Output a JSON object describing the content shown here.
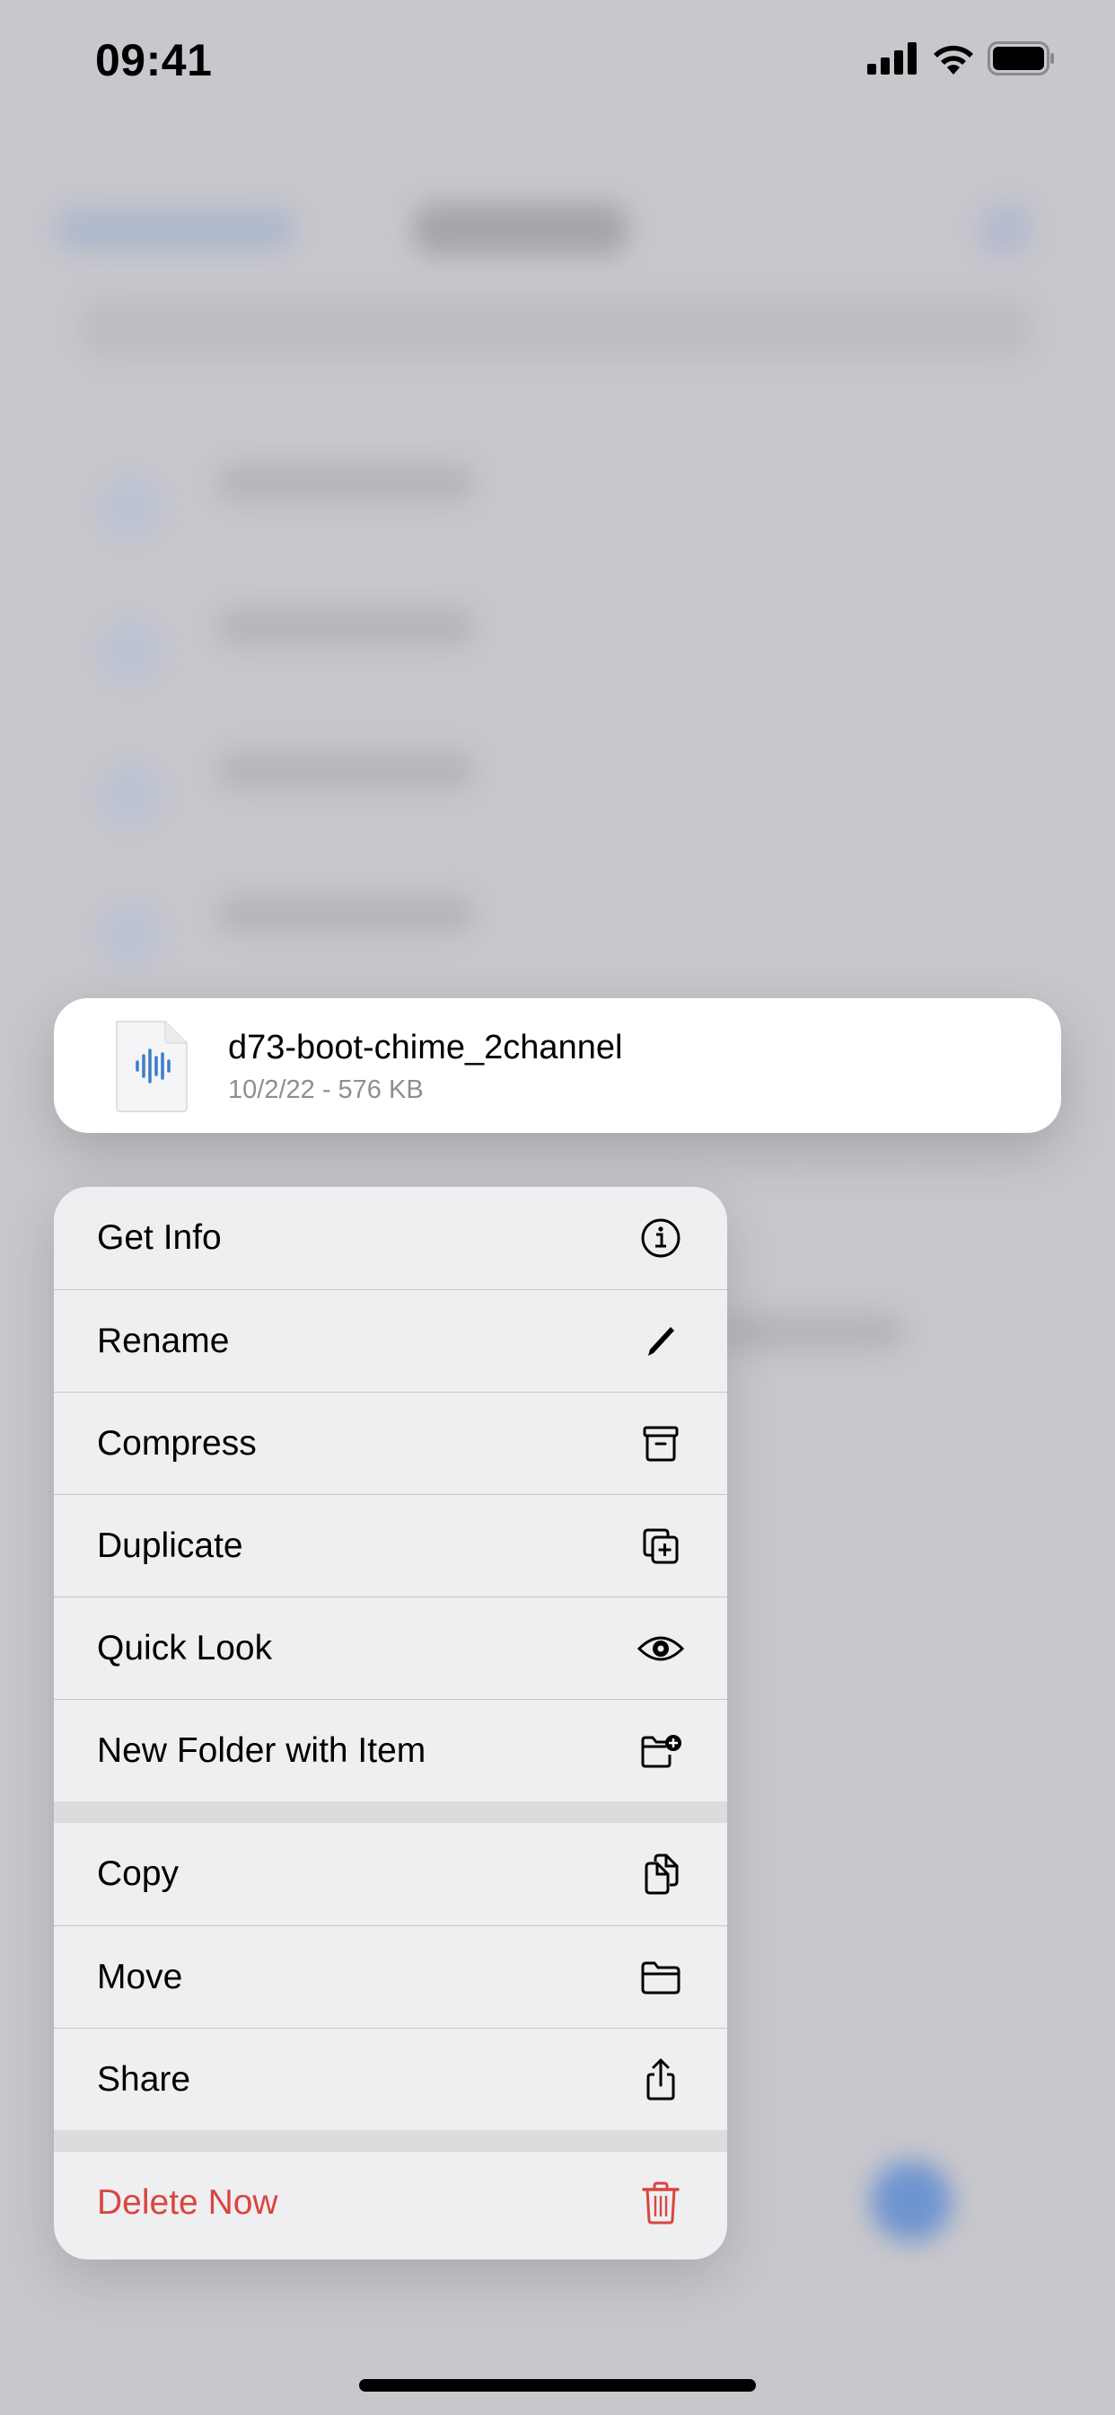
{
  "status_bar": {
    "time": "09:41",
    "icons": [
      "cellular-signal-icon",
      "wifi-icon",
      "battery-icon"
    ]
  },
  "preview": {
    "file_name": "d73-boot-chime_2channel",
    "file_meta": "10/2/22 - 576 KB",
    "icon": "audio-file-icon",
    "accent_color": "#3d7cc9"
  },
  "menu": {
    "sections": [
      {
        "items": [
          {
            "label": "Get Info",
            "icon": "info-circle-icon"
          },
          {
            "label": "Rename",
            "icon": "pencil-icon"
          },
          {
            "label": "Compress",
            "icon": "archive-box-icon"
          },
          {
            "label": "Duplicate",
            "icon": "plus-square-on-square-icon"
          },
          {
            "label": "Quick Look",
            "icon": "eye-icon"
          },
          {
            "label": "New Folder with Item",
            "icon": "folder-badge-plus-icon"
          }
        ]
      },
      {
        "items": [
          {
            "label": "Copy",
            "icon": "doc-on-doc-icon"
          },
          {
            "label": "Move",
            "icon": "folder-icon"
          },
          {
            "label": "Share",
            "icon": "share-icon"
          }
        ]
      },
      {
        "items": [
          {
            "label": "Delete Now",
            "icon": "trash-icon",
            "destructive": true
          }
        ]
      }
    ],
    "destructive_color": "#d9463e"
  }
}
